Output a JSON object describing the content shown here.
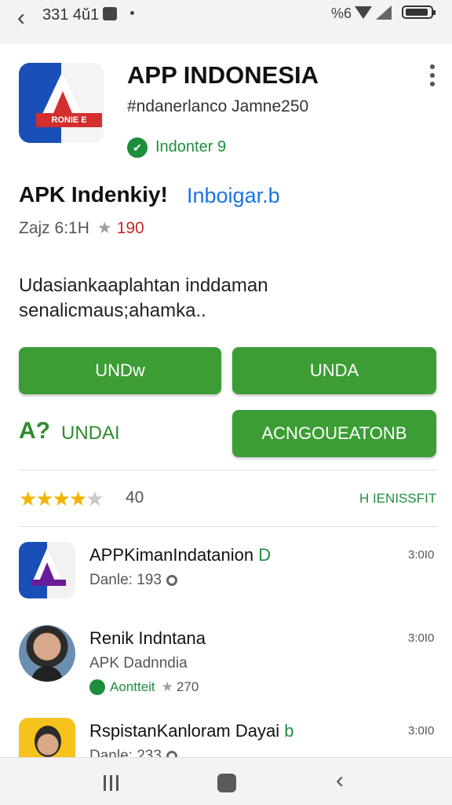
{
  "status_bar": {
    "time": "331 4ŭ1",
    "network": "%6"
  },
  "app": {
    "title": "APP INDONESIA",
    "developer": "#ndanerlanco Jamne250",
    "verified": "Indonter 9",
    "icon_banner": "RONIE E"
  },
  "subtitle": {
    "text": "APK Indenkiy!",
    "link": "Inboigar.b"
  },
  "meta": {
    "label": "Zajz 6:1H",
    "count": "190"
  },
  "description": {
    "line1": "Udasiankaaplahtan inddaman",
    "line2": "senalicmaus;ahamka.."
  },
  "buttons": {
    "btn1": "UNDw",
    "btn2": "UNDA",
    "btn3": "ACNGOUEATONB",
    "ap_label": "A?",
    "undai_label": "UNDAI"
  },
  "rating": {
    "value": 4.5,
    "stars": "★★★★",
    "half_star": "★",
    "count": "40",
    "link": "H IENISSFIT"
  },
  "list": [
    {
      "title": "APPKimanIndatanion",
      "mark": "D",
      "sub": "Danle: 193",
      "size": "3:0I0"
    },
    {
      "title": "Renik Indntana",
      "sub": "APK Dadnndia",
      "badge_text": "Aontteit",
      "badge_count": "270",
      "size": "3:0I0"
    },
    {
      "title": "RspistanKanloram Dayai",
      "mark": "b",
      "sub": "Danle: 233",
      "size": "3:0I0"
    }
  ],
  "icons": {
    "back": "back-arrow-icon",
    "more": "more-vert-icon",
    "verified": "check-circle-icon",
    "star": "star-icon"
  }
}
